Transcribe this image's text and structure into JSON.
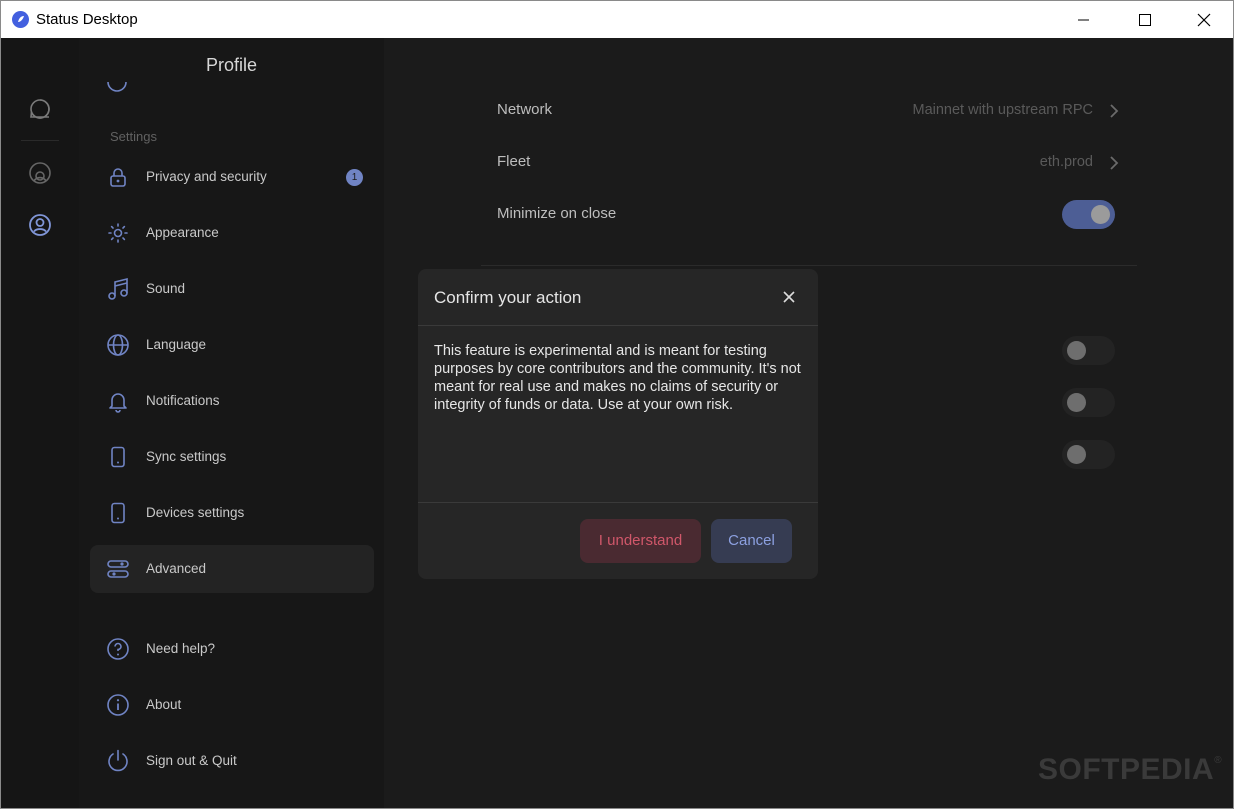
{
  "window": {
    "title": "Status Desktop"
  },
  "sidebar": {
    "title": "Profile",
    "section_label": "Settings",
    "items": [
      {
        "label": "Privacy and security",
        "icon": "lock-icon",
        "badge": "1"
      },
      {
        "label": "Appearance",
        "icon": "sun-icon"
      },
      {
        "label": "Sound",
        "icon": "music-note-icon"
      },
      {
        "label": "Language",
        "icon": "globe-icon"
      },
      {
        "label": "Notifications",
        "icon": "bell-icon"
      },
      {
        "label": "Sync settings",
        "icon": "phone-icon"
      },
      {
        "label": "Devices settings",
        "icon": "phone-icon"
      },
      {
        "label": "Advanced",
        "icon": "sliders-icon",
        "active": true
      }
    ],
    "footer_items": [
      {
        "label": "Need help?",
        "icon": "help-circle-icon"
      },
      {
        "label": "About",
        "icon": "info-circle-icon"
      },
      {
        "label": "Sign out & Quit",
        "icon": "power-icon"
      }
    ]
  },
  "main": {
    "network": {
      "label": "Network",
      "value": "Mainnet with upstream RPC"
    },
    "fleet": {
      "label": "Fleet",
      "value": "eth.prod"
    },
    "minimize": {
      "label": "Minimize on close",
      "enabled": true
    }
  },
  "dialog": {
    "title": "Confirm your action",
    "body": "This feature is experimental and is meant for testing purposes by core contributors and the community. It's not meant for real use and makes no claims of security or integrity of funds or data. Use at your own risk.",
    "confirm_label": "I understand",
    "cancel_label": "Cancel"
  },
  "watermark": {
    "text": "SOFTPEDIA",
    "mark": "®"
  },
  "colors": {
    "accent": "#4360df",
    "danger": "#d0576a",
    "toggle_on": "#4d5e95"
  }
}
